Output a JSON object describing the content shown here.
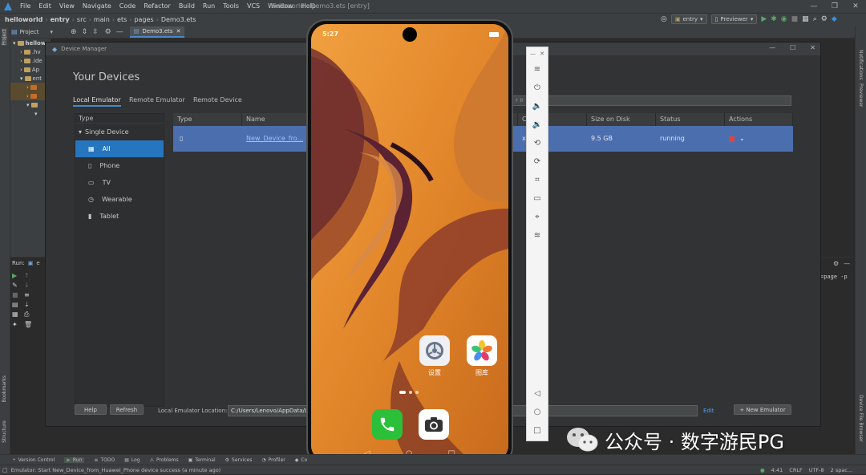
{
  "menu": {
    "items": [
      "File",
      "Edit",
      "View",
      "Navigate",
      "Code",
      "Refactor",
      "Build",
      "Run",
      "Tools",
      "VCS",
      "Window",
      "Help"
    ],
    "window_title": "helloworld - Demo3.ets [entry]"
  },
  "nav": {
    "crumbs": [
      "helloworld",
      "entry",
      "src",
      "main",
      "ets",
      "pages",
      "Demo3.ets"
    ],
    "module_combo": "entry",
    "previewer_combo": "Previewer"
  },
  "tool_strip": {
    "project_label": "Project",
    "open_tab": "Demo3.ets"
  },
  "left_stripe": {
    "project": "Project",
    "bookmarks": "Bookmarks",
    "structure": "Structure"
  },
  "right_stripe": {
    "notifications": "Notifications",
    "previewer": "Previewer",
    "device_file_browser": "Device File Browser"
  },
  "tree": {
    "root": "hellow",
    "nodes": [
      ".hv",
      ".ide",
      "Ap",
      "ent"
    ]
  },
  "run_panel": {
    "label": "Run:",
    "tab_prefix": "e",
    "output_right": "=page -p"
  },
  "device_manager": {
    "title": "Device Manager",
    "heading": "Your Devices",
    "tabs": [
      "Local Emulator",
      "Remote Emulator",
      "Remote Device"
    ],
    "type_panel": {
      "header": "Type",
      "group": "Single Device",
      "items": [
        {
          "label": "All",
          "icon": "grid-icon"
        },
        {
          "label": "Phone",
          "icon": "phone-icon"
        },
        {
          "label": "TV",
          "icon": "tv-icon"
        },
        {
          "label": "Wearable",
          "icon": "watch-icon"
        },
        {
          "label": "Tablet",
          "icon": "tablet-icon"
        }
      ]
    },
    "table": {
      "columns": [
        "Type",
        "Name",
        "CPU/ABI",
        "Size on Disk",
        "Status",
        "Actions"
      ],
      "rows": [
        {
          "name": "New_Device_fro...",
          "cpu": "x",
          "size": "9.5 GB",
          "status": "running"
        }
      ]
    },
    "footer": {
      "help": "Help",
      "refresh": "Refresh",
      "location_label": "Local Emulator Location:",
      "location_value": "C:/Users/Lenovo/AppData/Lo",
      "edit": "Edit",
      "new_emulator": "+ New Emulator"
    }
  },
  "phone": {
    "time": "5:27",
    "apps": [
      {
        "label": "设置",
        "icon": "settings-icon"
      },
      {
        "label": "图库",
        "icon": "gallery-icon"
      }
    ],
    "dock": [
      "phone-call-icon",
      "camera-icon"
    ]
  },
  "tool_windows": [
    "Version Control",
    "Run",
    "TODO",
    "Log",
    "Problems",
    "Terminal",
    "Services",
    "Profiler",
    "Co"
  ],
  "status": {
    "message": "Emulator: Start New_Device_from_Huawei_Phone device success (a minute ago)",
    "position": "4:41",
    "line_sep": "CRLF",
    "encoding": "UTF-8",
    "indent": "2 spac..."
  },
  "watermark": "公众号 · 数字游民PG",
  "colors": {
    "accent": "#4a88c7",
    "selection": "#2675bf",
    "row": "#4b6eaf",
    "wallpaper": "#e08a2a"
  }
}
